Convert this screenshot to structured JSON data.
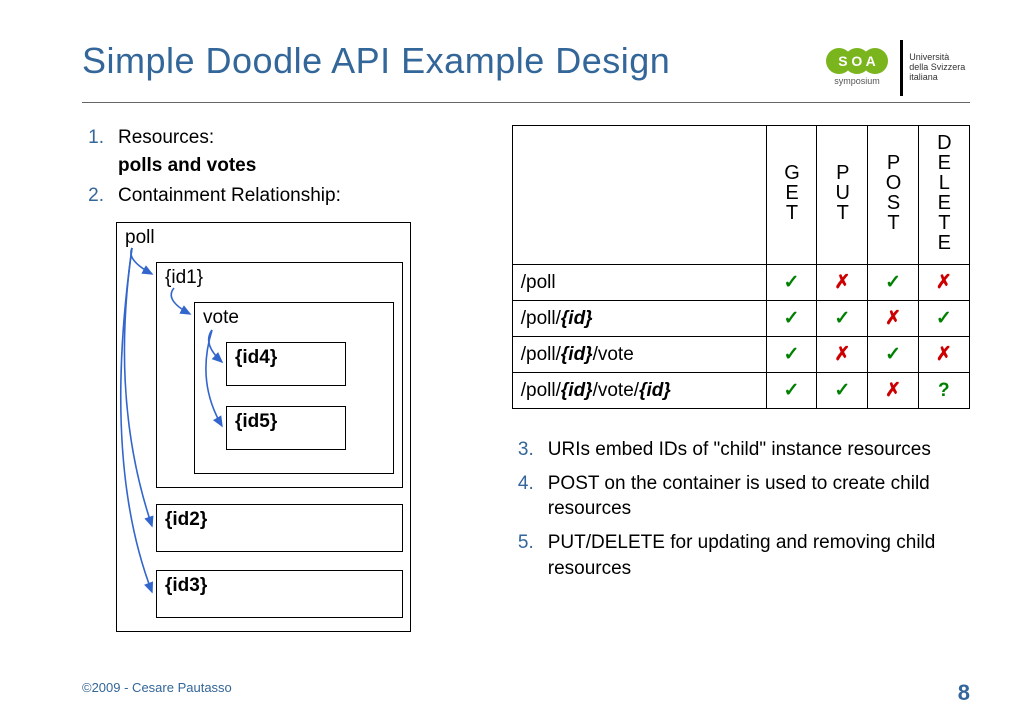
{
  "title": "Simple Doodle API Example Design",
  "logo": {
    "soa_top": "S O A",
    "soa_sub": "symposium",
    "usi": "Università della Svizzera italiana"
  },
  "list_top": [
    {
      "n": "1.",
      "text": "Resources:",
      "sub": "polls and votes"
    },
    {
      "n": "2.",
      "text": "Containment Relationship:"
    }
  ],
  "diagram": {
    "poll": "poll",
    "id1": "{id1}",
    "vote": "vote",
    "id4": "{id4}",
    "id5": "{id5}",
    "id2": "{id2}",
    "id3": "{id3}"
  },
  "table": {
    "cols": [
      "GET",
      "PUT",
      "POST",
      "DELETE"
    ],
    "rows": [
      {
        "label_plain": "/poll",
        "cells": [
          "check",
          "cross",
          "check",
          "cross"
        ]
      },
      {
        "label_pre": "/poll/",
        "label_em": "{id}",
        "label_post": "",
        "cells": [
          "check",
          "check",
          "cross",
          "check"
        ]
      },
      {
        "label_pre": "/poll/",
        "label_em": "{id}",
        "label_post": "/vote",
        "cells": [
          "check",
          "cross",
          "check",
          "cross"
        ]
      },
      {
        "label_pre": "/poll/",
        "label_em": "{id}",
        "label_mid": "/vote/",
        "label_em2": "{id}",
        "cells": [
          "check",
          "check",
          "cross",
          "question"
        ]
      }
    ]
  },
  "list_bottom": [
    {
      "n": "3.",
      "text": "URIs embed IDs of \"child\" instance resources"
    },
    {
      "n": "4.",
      "text": "POST on the container is used to create child resources"
    },
    {
      "n": "5.",
      "text": "PUT/DELETE for updating and removing child resources"
    }
  ],
  "footer": {
    "copyright": "©2009 - Cesare Pautasso",
    "page": "8"
  }
}
